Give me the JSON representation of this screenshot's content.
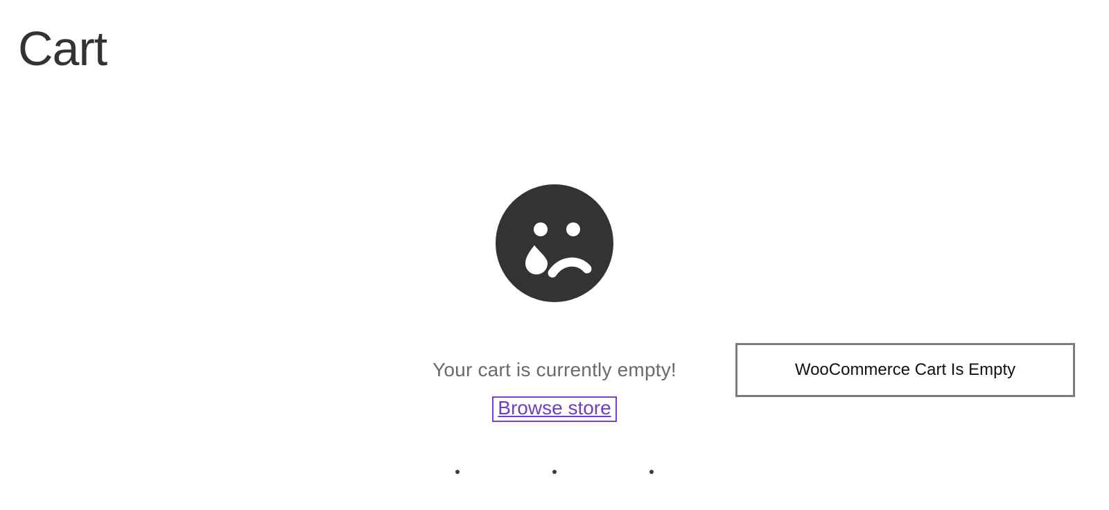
{
  "page": {
    "title": "Cart"
  },
  "empty_state": {
    "icon": "sad-face-icon",
    "message": "Your cart is currently empty!",
    "browse_label": "Browse store"
  },
  "annotation": {
    "label": "WooCommerce Cart Is Empty"
  },
  "colors": {
    "link": "#6b3fc9",
    "link_border": "#7d3bd8",
    "face": "#333333",
    "text_muted": "#6a6a6a",
    "annotation_border": "#7a7a7a"
  }
}
